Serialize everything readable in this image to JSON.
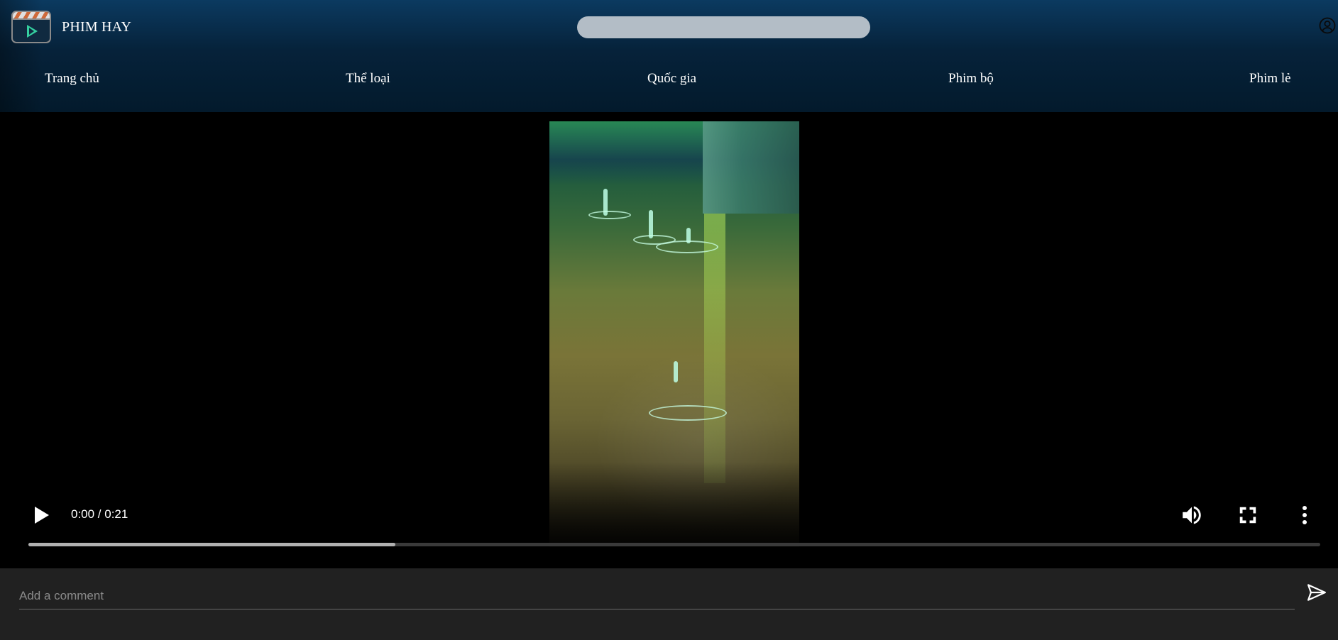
{
  "header": {
    "brand": "PHIM HAY",
    "search_placeholder": "",
    "user_icon": "user-circle-icon"
  },
  "nav": {
    "items": [
      {
        "label": "Trang chủ"
      },
      {
        "label": "Thể loại"
      },
      {
        "label": "Quốc gia"
      },
      {
        "label": "Phim bộ"
      },
      {
        "label": "Phim lẻ"
      }
    ]
  },
  "player": {
    "time": "0:00 / 0:21",
    "buffered_fraction": 0.284,
    "icons": {
      "play": "play-icon",
      "volume": "volume-icon",
      "fullscreen": "fullscreen-icon",
      "more": "more-vert-icon"
    }
  },
  "comments": {
    "placeholder": "Add a comment",
    "send_icon": "send-icon"
  },
  "colors": {
    "header_top": "#0b3a60",
    "header_bottom": "#031a2c",
    "search_bg": "#b3bdc6",
    "comment_bg": "#212121",
    "accent": "#35d0a0"
  }
}
